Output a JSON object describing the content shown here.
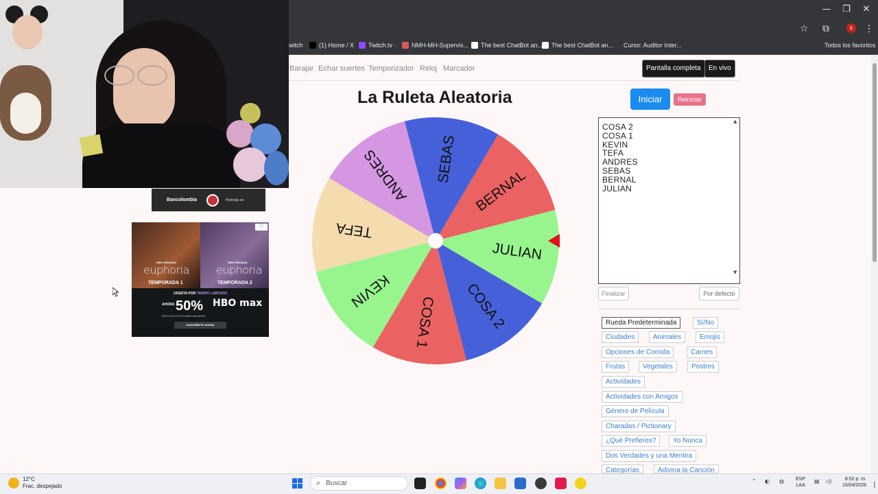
{
  "window": {
    "minimize": "—",
    "maximize": "❐",
    "close": "✕"
  },
  "bookmarks": [
    {
      "label": "witch",
      "color": "#35363a"
    },
    {
      "label": "(1) Home / X",
      "color": "#000000"
    },
    {
      "label": "Twitch.tv ·",
      "color": "#9146ff"
    },
    {
      "label": "NMH-MH-Supervis...",
      "color": "#d45a5a"
    },
    {
      "label": "The best ChatBot an...",
      "color": "#ffffff"
    },
    {
      "label": "The best ChatBot an...",
      "color": "#ffffff"
    },
    {
      "label": "Curso: Auditor Inter...",
      "color": "#35363a"
    },
    {
      "label": "Todos los favoritos",
      "color": "#35363a"
    }
  ],
  "banner": {
    "brand": "Bancolombia",
    "text": "Participa en"
  },
  "ad": {
    "show": "euphoria",
    "network": "HBO ORIGINAL",
    "season1": "TEMPORADA 1",
    "season2": "TEMPORADA 2",
    "offer_prefix": "OFERTA POR",
    "offer_em": "TIEMPO LIMITADO",
    "now": "AHORA",
    "percent": "50%",
    "off": "OFF",
    "brand": "HBO max",
    "fine": "SOLO EN LOS PLANES ANUALES",
    "cta": "SUSCRÍBETE AHORA"
  },
  "nav": {
    "links": [
      "Barajar",
      "Echar suertes",
      "Temporizador",
      "Reloj",
      "Marcador"
    ],
    "fullscreen": "Pantalla completa",
    "live": "En vivo"
  },
  "main": {
    "title": "La Ruleta Aleatoria",
    "start": "Iniciar",
    "reset": "Reiniciar",
    "finish": "Finalizar",
    "default": "Por defecto",
    "entries": [
      "COSA 2",
      "COSA 1",
      "KEVIN",
      "TEFA",
      "ANDRES",
      "SEBAS",
      "BERNAL",
      "JULIAN"
    ]
  },
  "wheel": {
    "rotation_deg": 98,
    "segments": [
      {
        "label": "JULIAN",
        "color": "#98f58d"
      },
      {
        "label": "COSA 2",
        "color": "#4660d9"
      },
      {
        "label": "COSA 1",
        "color": "#ea6262"
      },
      {
        "label": "KEVIN",
        "color": "#98f58d"
      },
      {
        "label": "TEFA",
        "color": "#f5dcaf"
      },
      {
        "label": "ANDRES",
        "color": "#d596e2"
      },
      {
        "label": "SEBAS",
        "color": "#4660d9"
      },
      {
        "label": "BERNAL",
        "color": "#ea6262"
      }
    ],
    "pointer_color": "#e0141a"
  },
  "presets": [
    "Rueda Predeterminada",
    "Sí/No",
    "Ciudades",
    "Animales",
    "Emojis",
    "Opciones de Comida",
    "Carnes",
    "Frutas",
    "Vegetales",
    "Postres",
    "Actividades",
    "Actividades con Amigos",
    "Género de Película",
    "Charadas / Pictionary",
    "¿Qué Prefieres?",
    "Yo Nunca",
    "Dos Verdades y una Mentira",
    "Categorías",
    "Adivina la Canción"
  ],
  "taskbar": {
    "temp": "12°C",
    "weather": "Frac. despejado",
    "search": "Buscar",
    "lang1": "ESP",
    "lang2": "LAA",
    "time": "8:52 p. m.",
    "date": "15/04/2026"
  }
}
